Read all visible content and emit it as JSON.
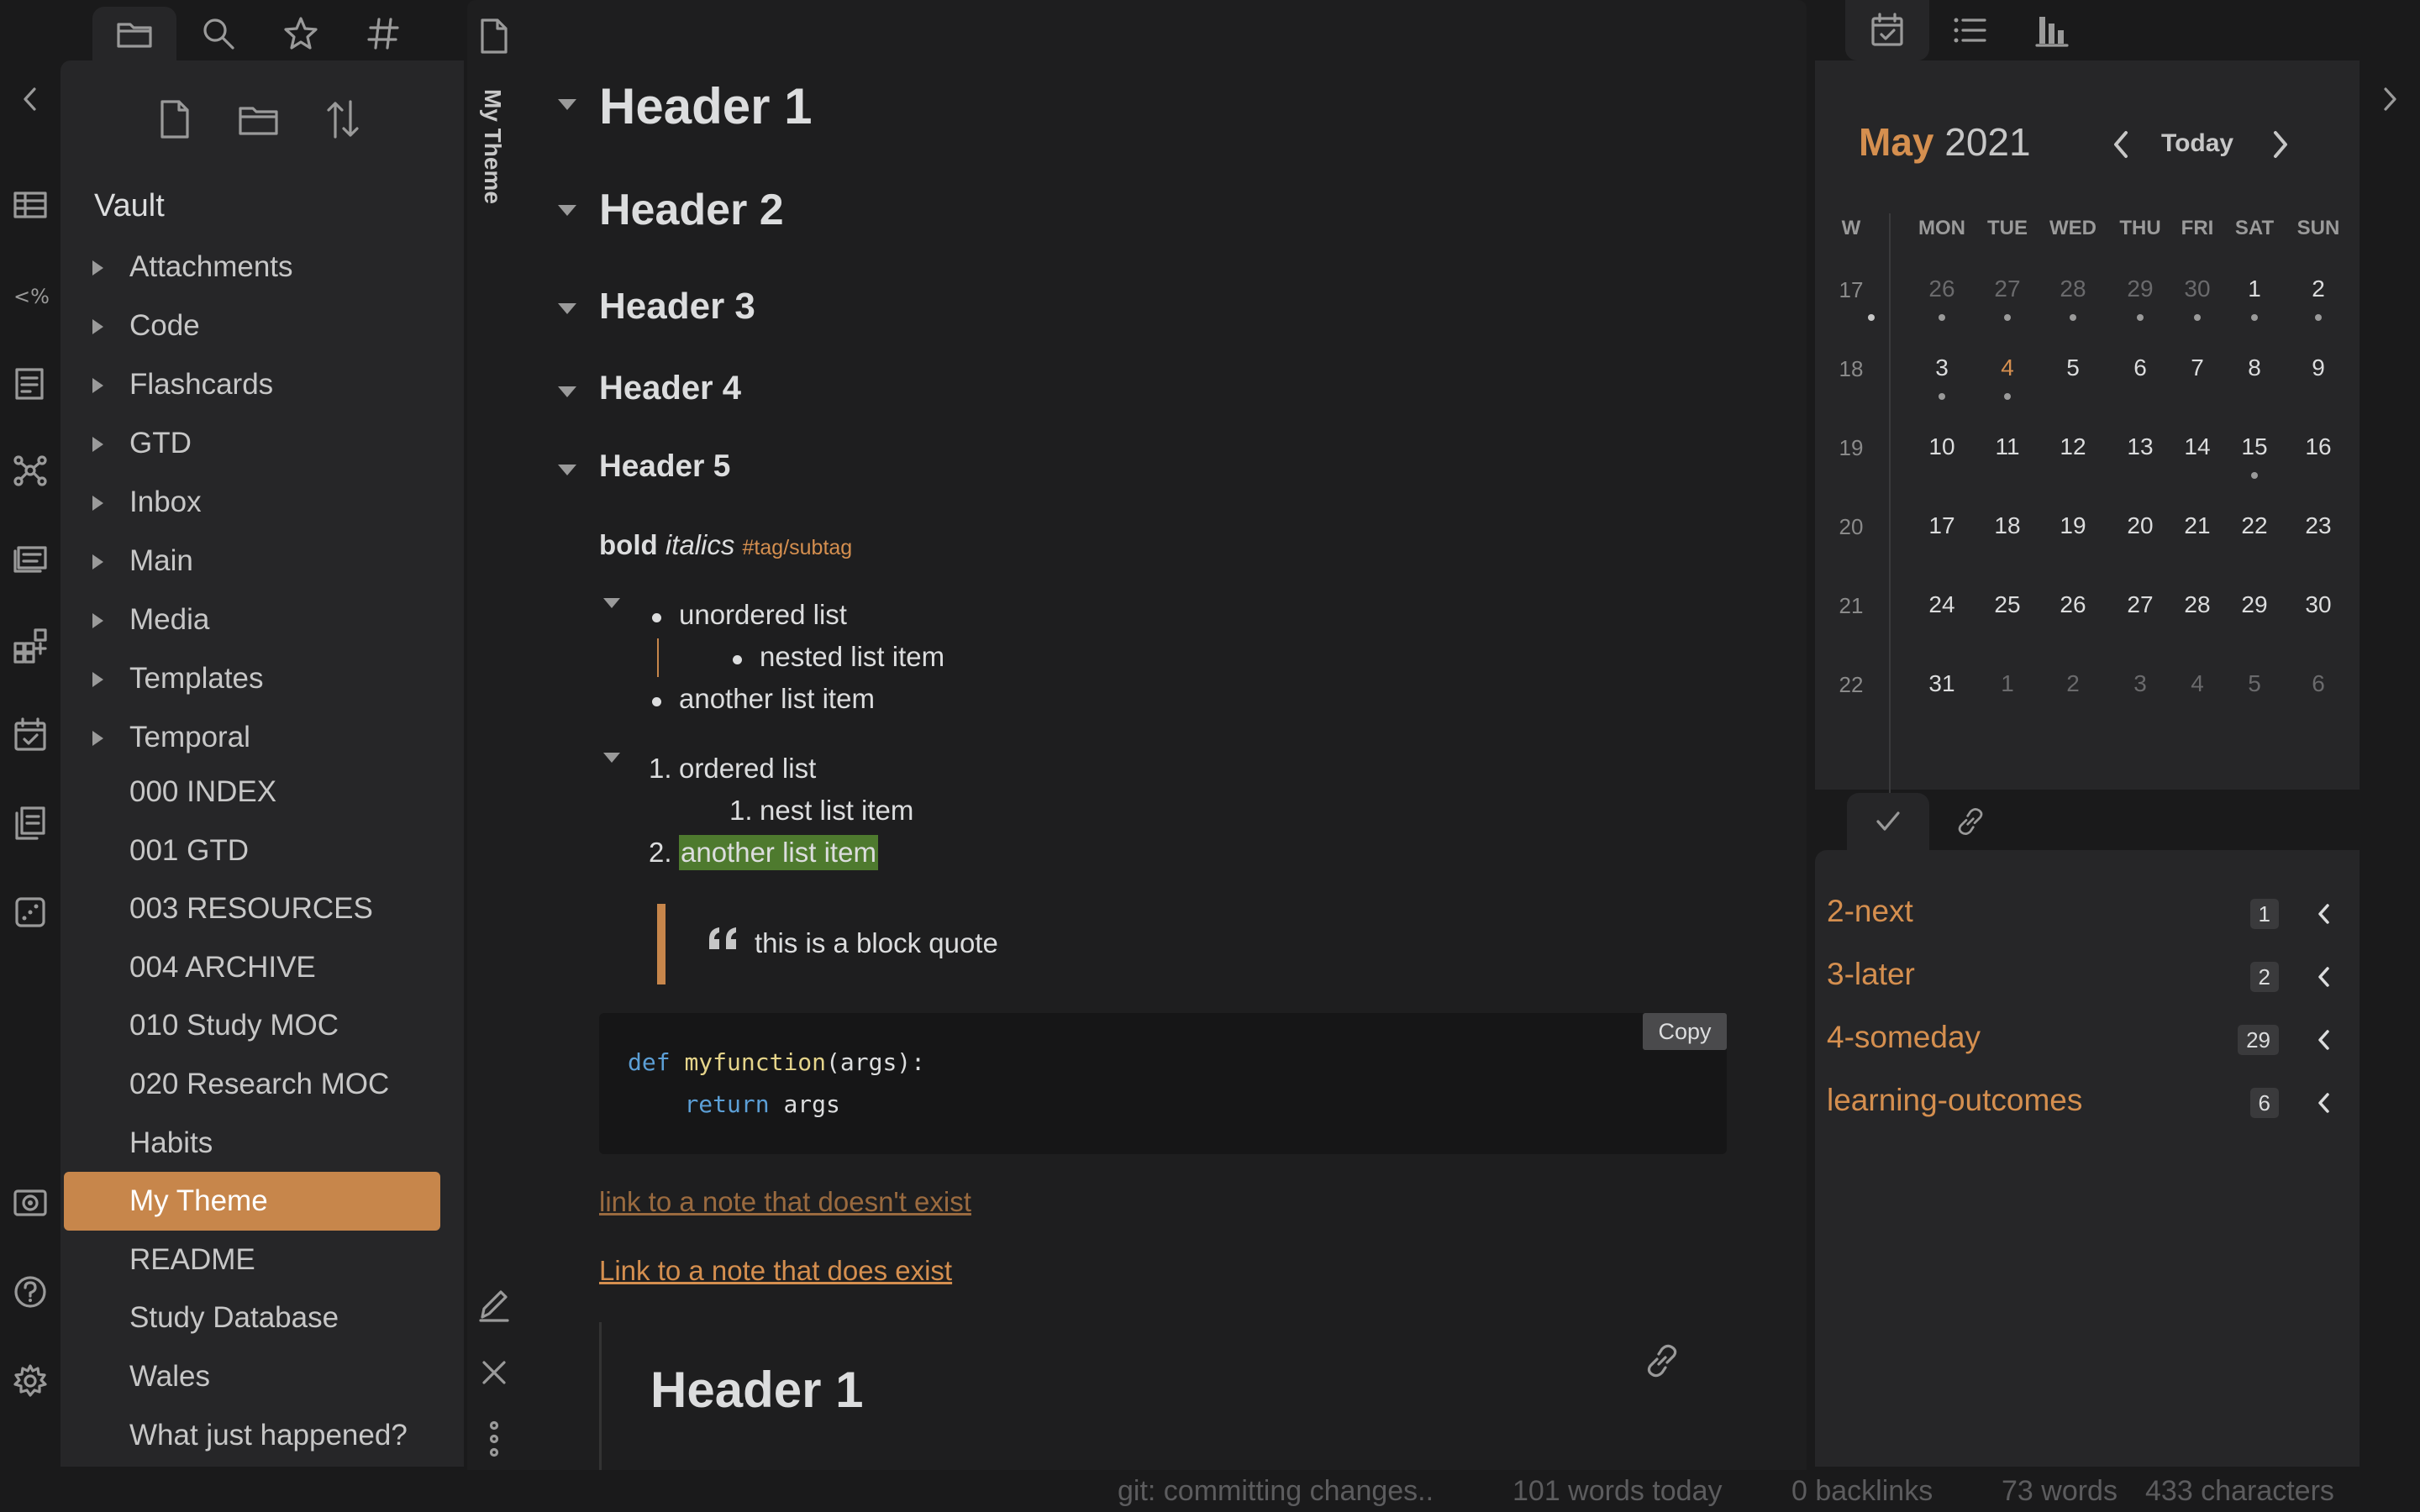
{
  "colors": {
    "accent": "#c7864b",
    "tag": "#d58f4f",
    "highlight": "#4e7a2e"
  },
  "left_sidebar": {
    "tabs": [
      "files-icon",
      "search-icon",
      "star-icon",
      "hash-icon"
    ],
    "vault_name": "Vault",
    "folders": [
      "Attachments",
      "Code",
      "Flashcards",
      "GTD",
      "Inbox",
      "Main",
      "Media",
      "Templates",
      "Temporal"
    ],
    "files": [
      "000 INDEX",
      "001 GTD",
      "003 RESOURCES",
      "004 ARCHIVE",
      "010 Study MOC",
      "020 Research MOC",
      "Habits",
      "My Theme",
      "README",
      "Study Database",
      "Wales",
      "What just happened?"
    ],
    "active_file": "My Theme"
  },
  "editor": {
    "tab_title": "My Theme",
    "headers": [
      "Header 1",
      "Header 2",
      "Header 3",
      "Header 4",
      "Header 5"
    ],
    "bold": "bold",
    "italics": "italics",
    "tag": "#tag/subtag",
    "ul": [
      "unordered list",
      "nested list item",
      "another list item"
    ],
    "ol": {
      "n1": "1.",
      "item1": "ordered list",
      "n_nested": "1.",
      "nested": "nest list item",
      "n2": "2.",
      "item2": "another list item"
    },
    "blockquote": "this is a block quote",
    "code_lines": [
      "def",
      "myfunction",
      "(args):",
      "return",
      "args"
    ],
    "copy_label": "Copy",
    "link_missing": "link to a note that doesn't exist",
    "link_existing": "Link to a note that does exist",
    "embed_header": "Header 1"
  },
  "calendar": {
    "month": "May",
    "year": "2021",
    "today_label": "Today",
    "headers": [
      "W",
      "MON",
      "TUE",
      "WED",
      "THU",
      "FRI",
      "SAT",
      "SUN"
    ],
    "weeks": [
      {
        "w": "17",
        "days": [
          "26",
          "27",
          "28",
          "29",
          "30",
          "1",
          "2"
        ]
      },
      {
        "w": "18",
        "days": [
          "3",
          "4",
          "5",
          "6",
          "7",
          "8",
          "9"
        ]
      },
      {
        "w": "19",
        "days": [
          "10",
          "11",
          "12",
          "13",
          "14",
          "15",
          "16"
        ]
      },
      {
        "w": "20",
        "days": [
          "17",
          "18",
          "19",
          "20",
          "21",
          "22",
          "23"
        ]
      },
      {
        "w": "21",
        "days": [
          "24",
          "25",
          "26",
          "27",
          "28",
          "29",
          "30"
        ]
      },
      {
        "w": "22",
        "days": [
          "31",
          "1",
          "2",
          "3",
          "4",
          "5",
          "6"
        ]
      }
    ]
  },
  "tags_pane": {
    "items": [
      {
        "name": "2-next",
        "count": "1"
      },
      {
        "name": "3-later",
        "count": "2"
      },
      {
        "name": "4-someday",
        "count": "29"
      },
      {
        "name": "learning-outcomes",
        "count": "6"
      }
    ]
  },
  "status_bar": {
    "git": "git: committing changes..",
    "words_today": "101 words today",
    "backlinks": "0 backlinks",
    "words": "73 words",
    "characters": "433 characters"
  }
}
